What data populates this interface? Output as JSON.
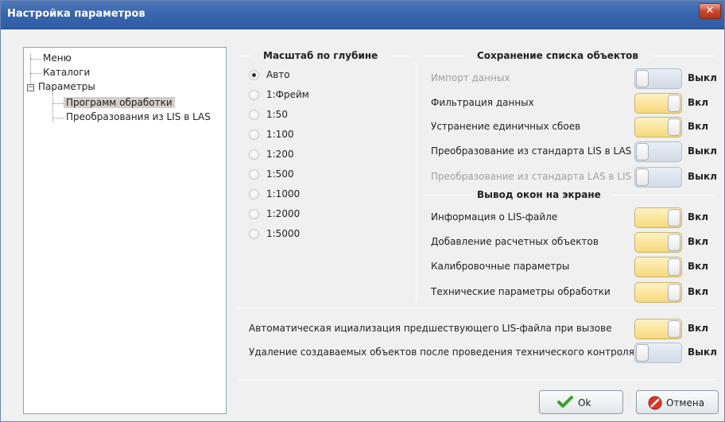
{
  "window": {
    "title": "Настройка параметров",
    "close_glyph": "✕"
  },
  "tree": {
    "items": [
      {
        "label": "Меню"
      },
      {
        "label": "Каталоги"
      },
      {
        "label": "Параметры",
        "expander": "−"
      },
      {
        "label": "Программ обработки"
      },
      {
        "label": "Преобразования из LIS в LAS"
      }
    ]
  },
  "depth_scale": {
    "title": "Масштаб по глубине",
    "options": [
      "Авто",
      "1:Фрейм",
      "1:50",
      "1:100",
      "1:200",
      "1:500",
      "1:1000",
      "1:2000",
      "1:5000"
    ],
    "selected": "Авто"
  },
  "save_objects": {
    "title": "Сохранение списка объектов",
    "rows": [
      {
        "label": "Импорт данных",
        "state": "Выкл",
        "on": false,
        "enabled": false
      },
      {
        "label": "Фильтрация данных",
        "state": "Вкл",
        "on": true,
        "enabled": true
      },
      {
        "label": "Устранение единичных сбоев",
        "state": "Вкл",
        "on": true,
        "enabled": true
      },
      {
        "label": "Преобразование из стандарта LIS в LAS",
        "state": "Выкл",
        "on": false,
        "enabled": true
      },
      {
        "label": "Преобразование из стандарта LAS в LIS",
        "state": "Выкл",
        "on": false,
        "enabled": false
      }
    ]
  },
  "windows_output": {
    "title": "Вывод окон на экране",
    "rows": [
      {
        "label": "Информация о LIS-файле",
        "state": "Вкл",
        "on": true
      },
      {
        "label": "Добавление расчетных объектов",
        "state": "Вкл",
        "on": true
      },
      {
        "label": "Калибровочные параметры",
        "state": "Вкл",
        "on": true
      },
      {
        "label": "Технические параметры обработки",
        "state": "Вкл",
        "on": true
      }
    ]
  },
  "bottom": {
    "rows": [
      {
        "label": "Автоматическая ициализация предшествующего LIS-файла при вызове",
        "state": "Вкл",
        "on": true
      },
      {
        "label": "Удаление создаваемых объектов после проведения технического контроля",
        "state": "Выкл",
        "on": false
      }
    ]
  },
  "buttons": {
    "ok": "Ok",
    "cancel": "Отмена"
  },
  "colors": {
    "toggle_on": "#f6d97b",
    "toggle_off": "#d3dbe6",
    "titlebar": "#3a66ad"
  },
  "icons": {
    "ok": "checkmark-icon",
    "cancel": "no-entry-icon"
  }
}
